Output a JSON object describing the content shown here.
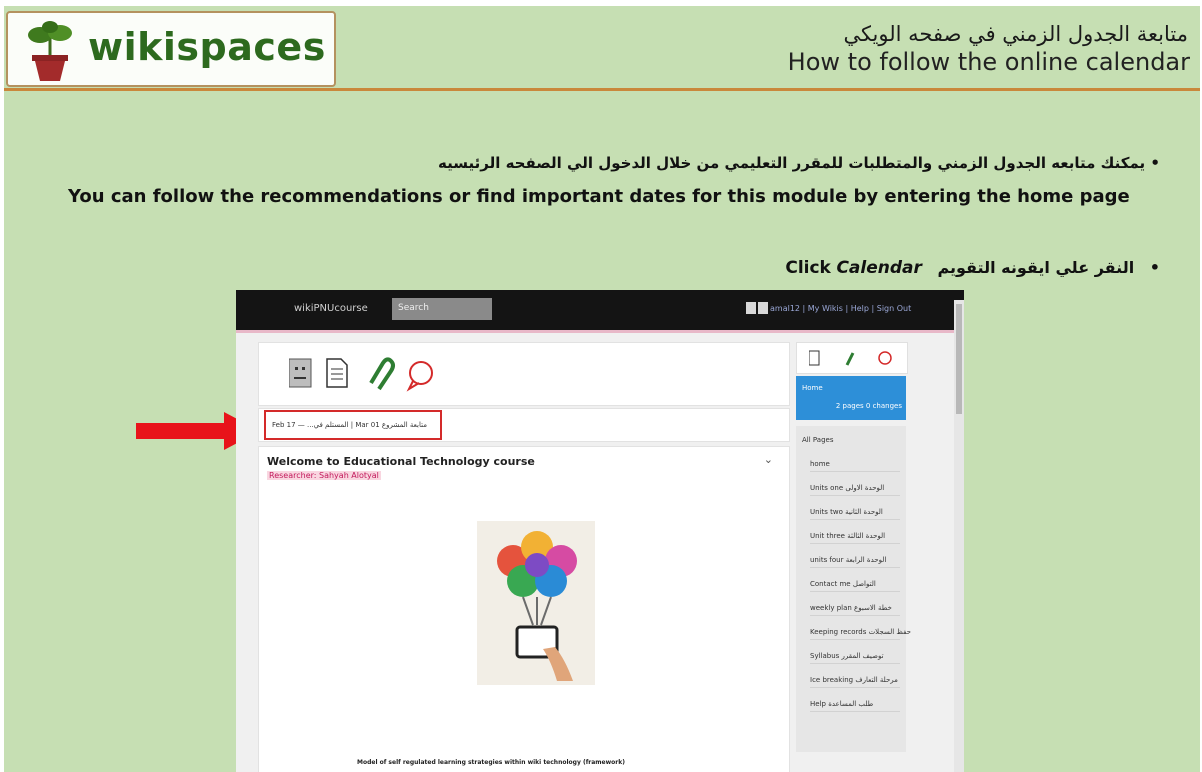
{
  "logo": {
    "text": "wikispaces"
  },
  "title": {
    "arabic": "متابعة الجدول الزمني في صفحه الويكي",
    "english": "How to follow the online calendar"
  },
  "bullets": {
    "first_arabic": "يمكنك متابعه الجدول الزمني والمتطلبات للمقرر التعليمي من خلال الدخول الي الصفحه الرئيسيه",
    "first_english": "You can follow the recommendations or find important dates for this module by entering the home page",
    "second_arabic": "النقر علي ايقونه التقويم",
    "second_click": "Click",
    "second_calendar": "Calendar",
    "bullet_char": "•"
  },
  "screenshot": {
    "brand": "wikiPNUcourse",
    "search_placeholder": "Search",
    "top_links": "amal12 | My Wikis | Help | Sign Out",
    "calendar_text": "Feb 17 — ...المستلم في | Mar 01 متابعة المشروع",
    "heading": "Welcome to Educational Technology course",
    "researcher": "Researcher: Sahyah Alotyal",
    "caption": "Model of self regulated learning strategies within wiki technology (framework)",
    "home_label": "Home",
    "home_stats": "2 pages  0 changes",
    "all_pages": "All Pages",
    "pages": [
      "home",
      "Units one الوحدة الاولى",
      "Units two الوحدة الثانية",
      "Unit three الوحدة الثالثة",
      "units four الوحدة الرابعة",
      "Contact me التواصل",
      "weekly plan خطة الاسبوع",
      "Keeping records حفظ السجلات",
      "Syllabus توصيف المقرر",
      "Ice breaking مرحلة التعارف",
      "Help طلب المساعدة"
    ]
  }
}
